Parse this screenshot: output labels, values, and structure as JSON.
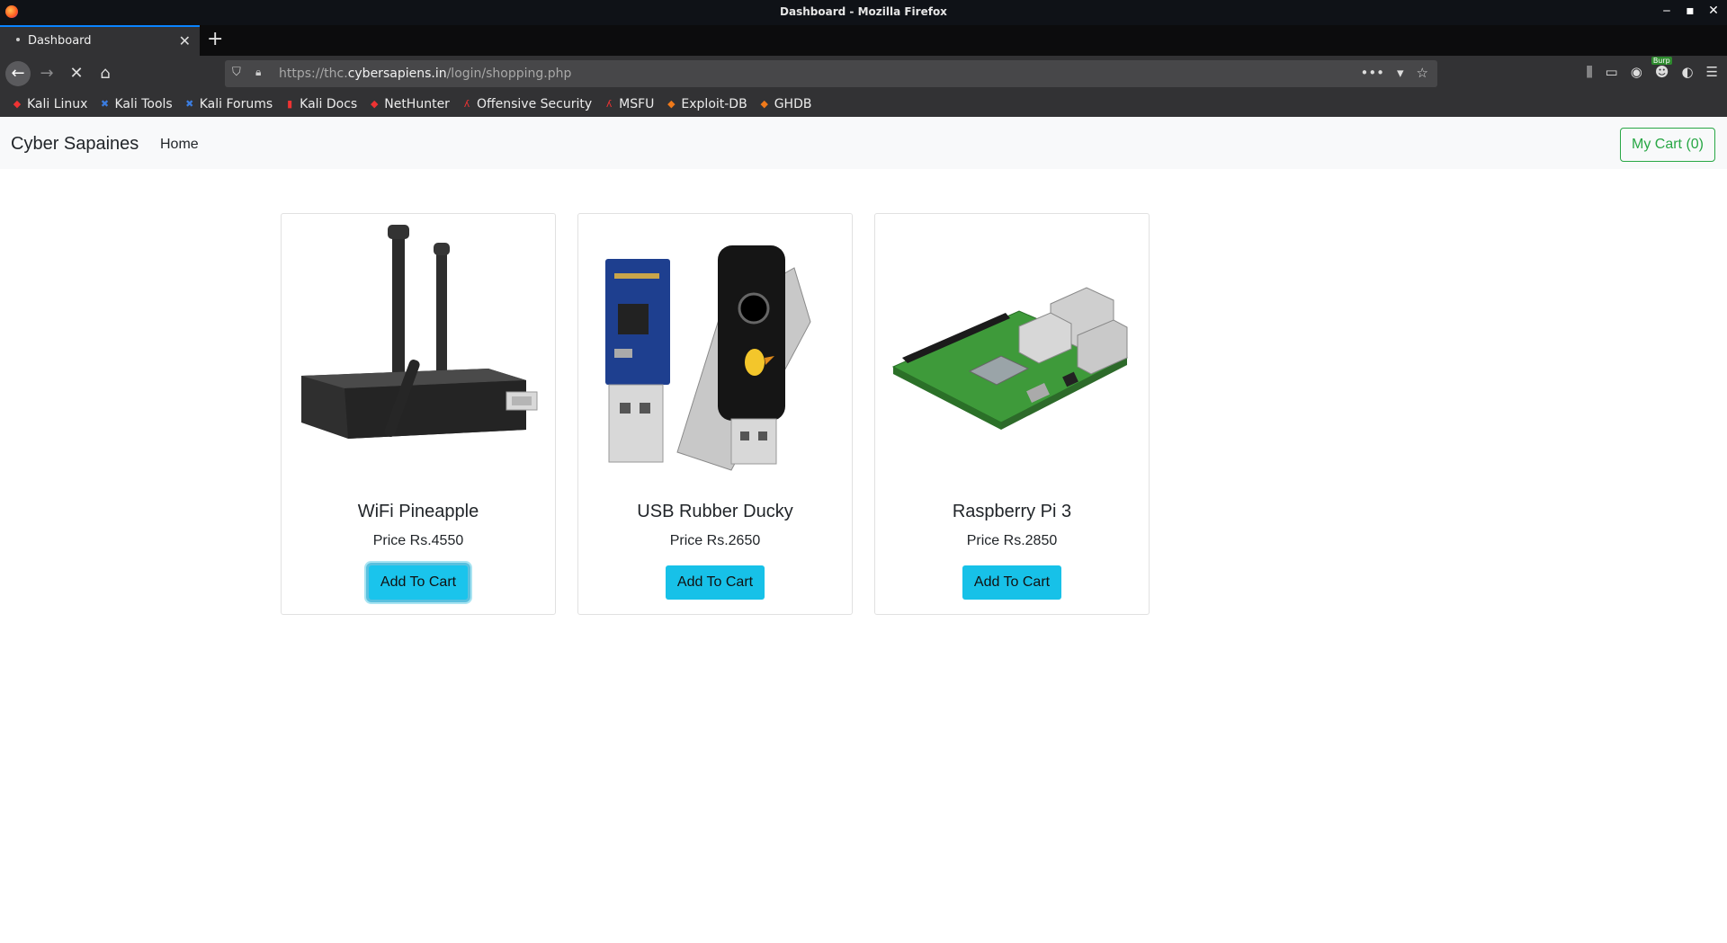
{
  "window": {
    "title": "Dashboard - Mozilla Firefox"
  },
  "tabs": [
    {
      "label": "Dashboard"
    }
  ],
  "address_bar": {
    "url_prefix": "https://thc.",
    "url_domain": "cybersapiens.in",
    "url_path": "/login/shopping.php"
  },
  "bookmarks": [
    {
      "label": "Kali Linux",
      "icon": "kali-dragon-icon"
    },
    {
      "label": "Kali Tools",
      "icon": "kali-tools-icon"
    },
    {
      "label": "Kali Forums",
      "icon": "kali-forums-icon"
    },
    {
      "label": "Kali Docs",
      "icon": "kali-docs-icon"
    },
    {
      "label": "NetHunter",
      "icon": "nethunter-icon"
    },
    {
      "label": "Offensive Security",
      "icon": "offsec-icon"
    },
    {
      "label": "MSFU",
      "icon": "msfu-icon"
    },
    {
      "label": "Exploit-DB",
      "icon": "exploitdb-icon"
    },
    {
      "label": "GHDB",
      "icon": "ghdb-icon"
    }
  ],
  "toolbar": {
    "burp_badge": "Burp"
  },
  "site": {
    "brand": "Cyber Sapaines",
    "home_link": "Home",
    "cart_button": "My Cart (0)"
  },
  "products": [
    {
      "name": "WiFi Pineapple",
      "price": "Price Rs.4550",
      "button": "Add To Cart",
      "image": "wifi-pineapple"
    },
    {
      "name": "USB Rubber Ducky",
      "price": "Price Rs.2650",
      "button": "Add To Cart",
      "image": "usb-rubber-ducky"
    },
    {
      "name": "Raspberry Pi 3",
      "price": "Price Rs.2850",
      "button": "Add To Cart",
      "image": "raspberry-pi"
    }
  ],
  "colors": {
    "button_bg": "#17c1e8",
    "cart_outline": "#28a745",
    "tab_accent": "#0a84ff"
  }
}
